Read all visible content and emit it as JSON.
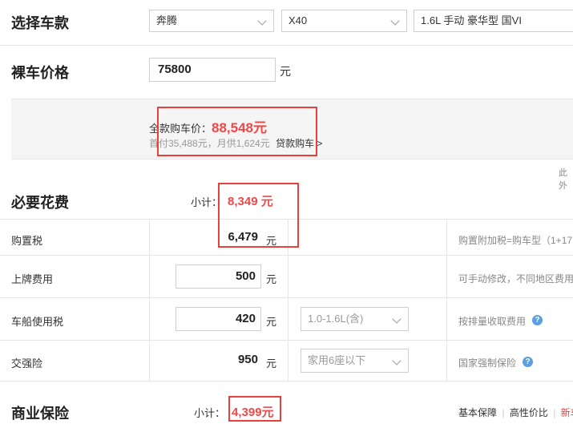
{
  "select_model": {
    "title": "选择车款",
    "brand": "奔腾",
    "series": "X40",
    "trim": "1.6L 手动 豪华型 国VI"
  },
  "bare_price": {
    "title": "裸车价格",
    "value": "75800",
    "unit": "元"
  },
  "summary": {
    "full_label": "全款购车价：",
    "full_value": "88,548元",
    "loan_text": "首付35,488元，月供1,624元",
    "loan_link": "贷款购车 >",
    "right_note": "此外"
  },
  "required": {
    "title": "必要花费",
    "subtotal_label": "小计：",
    "subtotal_value": "8,349 元",
    "rows": [
      {
        "label": "购置税",
        "value": "6,479",
        "unit": "元",
        "note": "购置附加税=购车型（1+17"
      },
      {
        "label": "上牌费用",
        "value": "500",
        "unit": "元",
        "note": "可手动修改，不同地区费用"
      },
      {
        "label": "车船使用税",
        "value": "420",
        "unit": "元",
        "option": "1.0-1.6L(含)",
        "note": "按排量收取费用"
      },
      {
        "label": "交强险",
        "value": "950",
        "unit": "元",
        "option": "家用6座以下",
        "note": "国家强制保险"
      }
    ]
  },
  "insurance": {
    "title": "商业保险",
    "subtotal_label": "小计：",
    "subtotal_value": "4,399元",
    "tabs": [
      "基本保障",
      "高性价比",
      "新车"
    ]
  },
  "icons": {
    "help": "question-circle-icon",
    "dropdown": "chevron-down-icon"
  },
  "colors": {
    "accent_red": "#f04848",
    "box_red": "#e8403d",
    "help_blue": "#5aa0e0"
  }
}
